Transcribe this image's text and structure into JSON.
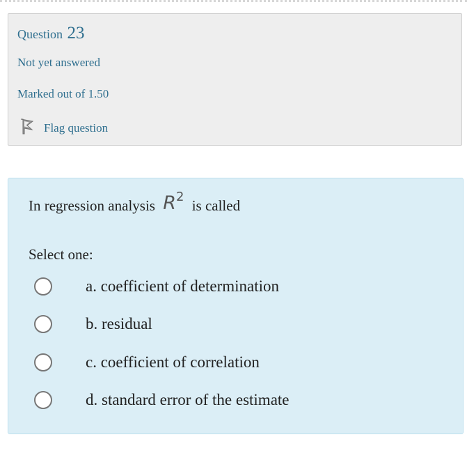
{
  "info": {
    "question_label": "Question",
    "question_number": "23",
    "state": "Not yet answered",
    "grade": "Marked out of 1.50",
    "flag_label": "Flag question",
    "flag_icon": "flag-icon"
  },
  "question": {
    "text_before": "In regression analysis",
    "math_symbol": "R",
    "math_superscript": "2",
    "text_after": "is called",
    "prompt": "Select one:",
    "options": [
      {
        "label": "a. coefficient of determination"
      },
      {
        "label": "b. residual"
      },
      {
        "label": "c. coefficient of correlation"
      },
      {
        "label": "d. standard error of the estimate"
      }
    ]
  },
  "colors": {
    "link_blue": "#2f6f8f",
    "info_bg": "#eeeeee",
    "content_bg": "#dbeef6"
  }
}
